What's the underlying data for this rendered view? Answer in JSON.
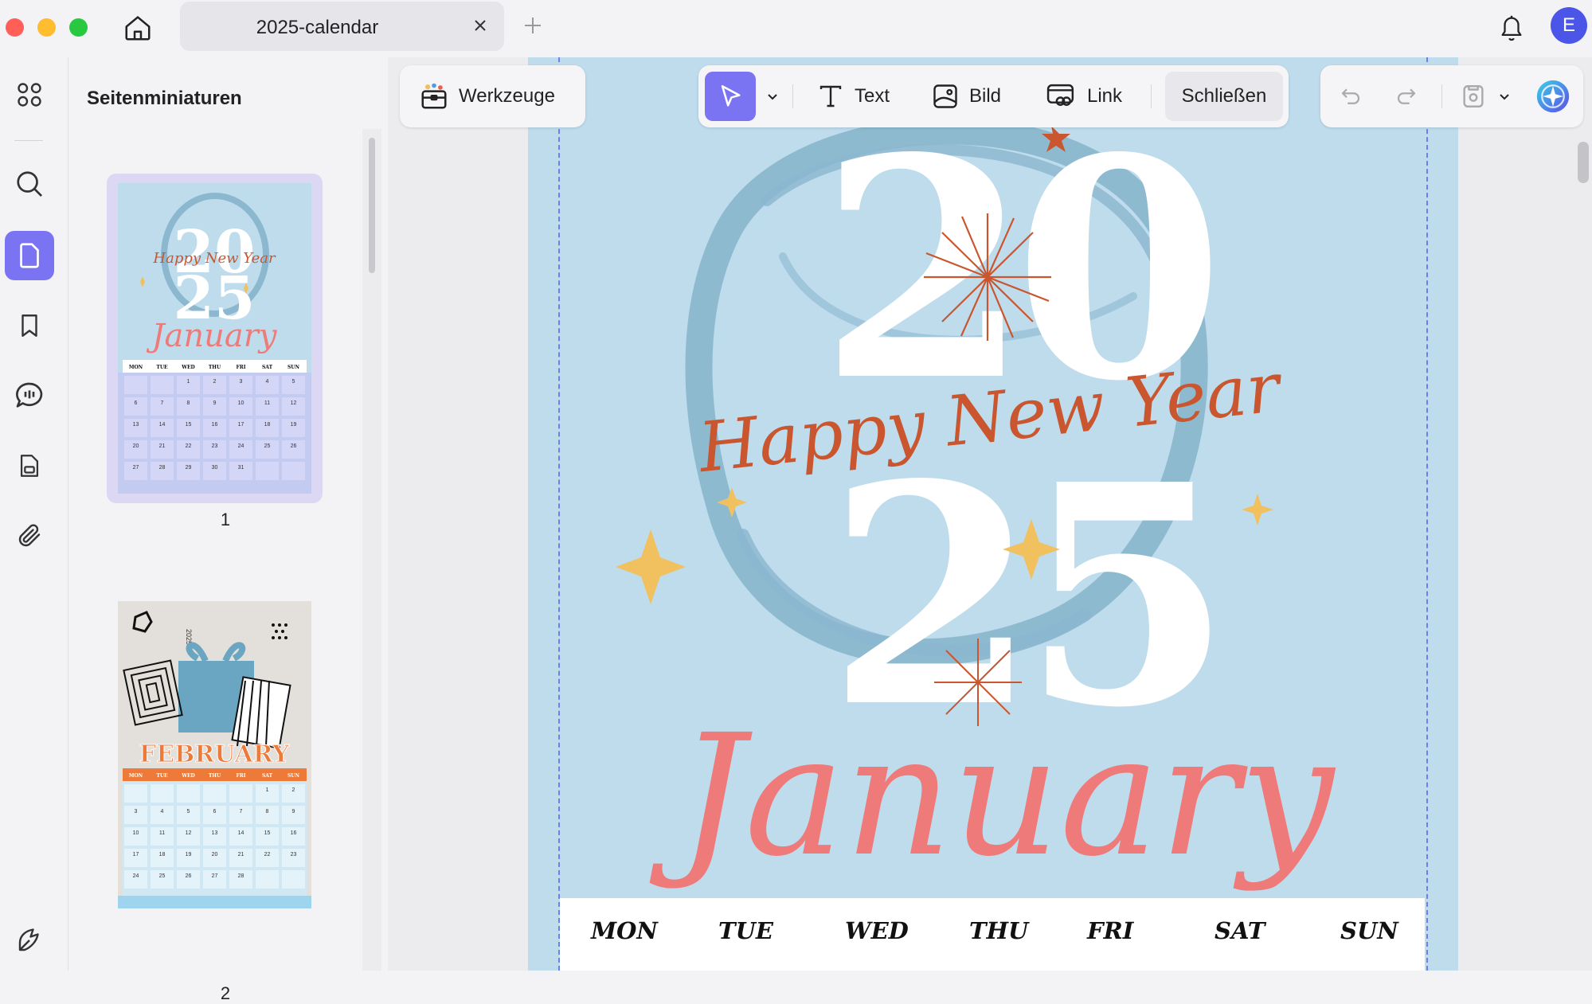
{
  "tab": {
    "title": "2025-calendar"
  },
  "avatar": {
    "initial": "E"
  },
  "sidebar": {
    "title": "Seitenminiaturen"
  },
  "thumbnails": [
    {
      "page_number": "1",
      "month": "January",
      "headline": "Happy New Year",
      "year": "2025"
    },
    {
      "page_number": "2",
      "month": "FEBRUARY",
      "year": "2025"
    }
  ],
  "thumb_weekdays": [
    "MON",
    "TUE",
    "WED",
    "THU",
    "FRI",
    "SAT",
    "SUN"
  ],
  "thumb_jan_dates": [
    "",
    "",
    "1",
    "2",
    "3",
    "4",
    "5",
    "6",
    "7",
    "8",
    "9",
    "10",
    "11",
    "12",
    "13",
    "14",
    "15",
    "16",
    "17",
    "18",
    "19",
    "20",
    "21",
    "22",
    "23",
    "24",
    "25",
    "26",
    "27",
    "28",
    "29",
    "30",
    "31",
    "",
    ""
  ],
  "thumb_feb_dates": [
    "",
    "",
    "",
    "",
    "",
    "1",
    "2",
    "3",
    "4",
    "5",
    "6",
    "7",
    "8",
    "9",
    "10",
    "11",
    "12",
    "13",
    "14",
    "15",
    "16",
    "17",
    "18",
    "19",
    "20",
    "21",
    "22",
    "23",
    "24",
    "25",
    "26",
    "27",
    "28",
    "",
    ""
  ],
  "toolbar": {
    "tools_label": "Werkzeuge",
    "text_label": "Text",
    "image_label": "Bild",
    "link_label": "Link",
    "close_label": "Schließen"
  },
  "page": {
    "year_top": "20",
    "year_bottom": "25",
    "headline": "Happy New Year",
    "month": "January",
    "weekdays": [
      "MON",
      "TUE",
      "WED",
      "THU",
      "FRI",
      "SAT",
      "SUN"
    ]
  },
  "colors": {
    "accent": "#7a74f2",
    "page_bg": "#bedcec",
    "month": "#ef7a7a",
    "headline": "#c9562e",
    "sparkle": "#f1c160",
    "ring": "#8bb7cf"
  },
  "icons": [
    "home-icon",
    "close-icon",
    "plus-icon",
    "bell-icon",
    "grid-icon",
    "search-icon",
    "page-icon",
    "bookmark-icon",
    "comment-icon",
    "form-icon",
    "paperclip-icon",
    "pen-icon",
    "toolbox-icon",
    "cursor-icon",
    "chevron-down-icon",
    "text-icon",
    "image-icon",
    "link-icon",
    "undo-icon",
    "redo-icon",
    "save-icon",
    "ai-assistant-icon"
  ]
}
